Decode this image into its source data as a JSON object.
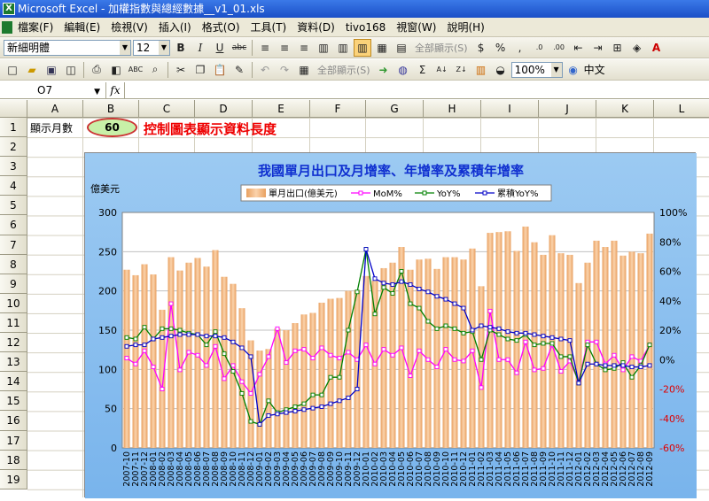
{
  "window": {
    "title": "Microsoft Excel - 加權指數與總經數據__v1_01.xls",
    "app_icon": "excel-icon"
  },
  "menu": [
    "檔案(F)",
    "編輯(E)",
    "檢視(V)",
    "插入(I)",
    "格式(O)",
    "工具(T)",
    "資料(D)",
    "tivo168",
    "視窗(W)",
    "說明(H)"
  ],
  "toolbar": {
    "font": "新細明體",
    "size": "12",
    "show_all_1": "全部顯示(S)",
    "show_all_2": "全部顯示(S)",
    "zoom": "100%",
    "lang": "中文"
  },
  "formula_bar": {
    "cell_ref": "O7",
    "fx": "fx",
    "content": ""
  },
  "columns": [
    "A",
    "B",
    "C",
    "D",
    "E",
    "F",
    "G",
    "H",
    "I",
    "J",
    "K",
    "L"
  ],
  "rows": [
    "1",
    "2",
    "3",
    "4",
    "5",
    "6",
    "7",
    "8",
    "9",
    "10",
    "11",
    "12",
    "13",
    "14",
    "15",
    "16",
    "17",
    "18",
    "19"
  ],
  "sheet": {
    "a1_label": "顯示月數",
    "b1_value": "60",
    "c1_note": "控制圖表顯示資料長度"
  },
  "colors": {
    "bar": "#f2bc8c",
    "mom": "#ff00ff",
    "yoy": "#008000",
    "cum": "#0000c8",
    "title": "#1030d0",
    "neg_axis": "#e00000"
  },
  "chart_data": {
    "type": "bar",
    "title": "我國單月出口及月增率、年增率及累積年增率",
    "ylabel": "億美元",
    "ylim": [
      0,
      300
    ],
    "y2lim": [
      -0.6,
      1.0
    ],
    "yticks": [
      "0",
      "50",
      "100",
      "150",
      "200",
      "250",
      "300"
    ],
    "y2ticks": [
      "-60%",
      "-40%",
      "-20%",
      "0%",
      "20%",
      "40%",
      "60%",
      "80%",
      "100%"
    ],
    "legend": [
      "單月出口(億美元)",
      "MoM%",
      "YoY%",
      "累積YoY%"
    ],
    "legend_position": "top",
    "categories": [
      "2007-10",
      "2007-11",
      "2007-12",
      "2008-01",
      "2008-02",
      "2008-03",
      "2008-04",
      "2008-05",
      "2008-06",
      "2008-07",
      "2008-08",
      "2008-09",
      "2008-10",
      "2008-11",
      "2008-12",
      "2009-01",
      "2009-02",
      "2009-03",
      "2009-04",
      "2009-05",
      "2009-06",
      "2009-07",
      "2009-08",
      "2009-09",
      "2009-10",
      "2009-11",
      "2009-12",
      "2010-01",
      "2010-02",
      "2010-03",
      "2010-04",
      "2010-05",
      "2010-06",
      "2010-07",
      "2010-08",
      "2010-09",
      "2010-10",
      "2010-11",
      "2010-12",
      "2011-01",
      "2011-02",
      "2011-03",
      "2011-04",
      "2011-05",
      "2011-06",
      "2011-07",
      "2011-08",
      "2011-09",
      "2011-10",
      "2011-11",
      "2011-12",
      "2012-01",
      "2012-02",
      "2012-03",
      "2012-04",
      "2012-05",
      "2012-06",
      "2012-07",
      "2012-08",
      "2012-09"
    ],
    "series": [
      {
        "name": "單月出口(億美元)",
        "type": "bar",
        "values": [
          227,
          220,
          234,
          221,
          176,
          243,
          226,
          236,
          242,
          231,
          252,
          218,
          209,
          178,
          137,
          124,
          126,
          152,
          150,
          159,
          170,
          172,
          185,
          190,
          191,
          200,
          201,
          219,
          213,
          229,
          236,
          256,
          227,
          240,
          241,
          228,
          243,
          243,
          240,
          254,
          206,
          274,
          275,
          276,
          251,
          282,
          262,
          246,
          271,
          248,
          246,
          210,
          236,
          264,
          256,
          264,
          245,
          250,
          248,
          273
        ]
      },
      {
        "name": "MoM%",
        "type": "line",
        "values": [
          0.01,
          -0.03,
          0.06,
          -0.05,
          -0.2,
          0.38,
          -0.07,
          0.05,
          0.03,
          -0.04,
          0.09,
          -0.13,
          -0.04,
          -0.15,
          -0.23,
          -0.1,
          0.02,
          0.21,
          -0.02,
          0.06,
          0.07,
          0.01,
          0.08,
          0.03,
          0.01,
          0.05,
          0.0,
          0.1,
          -0.03,
          0.07,
          0.03,
          0.08,
          -0.11,
          0.06,
          0.0,
          -0.05,
          0.07,
          0.0,
          -0.01,
          0.06,
          -0.19,
          0.33,
          0.0,
          0.0,
          -0.09,
          0.12,
          -0.07,
          -0.06,
          0.1,
          -0.08,
          -0.01,
          -0.15,
          0.12,
          0.12,
          -0.03,
          0.03,
          -0.07,
          0.02,
          -0.01,
          0.1
        ]
      },
      {
        "name": "YoY%",
        "type": "line",
        "values": [
          0.15,
          0.14,
          0.22,
          0.14,
          0.21,
          0.21,
          0.2,
          0.18,
          0.17,
          0.1,
          0.19,
          0.04,
          -0.08,
          -0.23,
          -0.42,
          -0.44,
          -0.28,
          -0.36,
          -0.34,
          -0.32,
          -0.3,
          -0.24,
          -0.24,
          -0.12,
          -0.12,
          0.2,
          0.46,
          0.75,
          0.31,
          0.49,
          0.45,
          0.6,
          0.38,
          0.35,
          0.26,
          0.21,
          0.23,
          0.21,
          0.18,
          0.19,
          0.0,
          0.2,
          0.17,
          0.14,
          0.13,
          0.17,
          0.1,
          0.11,
          0.11,
          0.02,
          0.02,
          -0.16,
          0.1,
          -0.03,
          -0.07,
          -0.06,
          -0.02,
          -0.12,
          -0.04,
          0.1
        ]
      },
      {
        "name": "累積YoY%",
        "type": "line",
        "values": [
          0.09,
          0.1,
          0.1,
          0.14,
          0.15,
          0.16,
          0.17,
          0.17,
          0.17,
          0.16,
          0.16,
          0.15,
          0.12,
          0.08,
          0.02,
          -0.44,
          -0.38,
          -0.37,
          -0.36,
          -0.35,
          -0.34,
          -0.33,
          -0.32,
          -0.3,
          -0.28,
          -0.26,
          -0.2,
          0.75,
          0.55,
          0.52,
          0.51,
          0.53,
          0.51,
          0.48,
          0.46,
          0.43,
          0.41,
          0.38,
          0.35,
          0.2,
          0.23,
          0.22,
          0.21,
          0.19,
          0.18,
          0.18,
          0.17,
          0.16,
          0.15,
          0.14,
          0.13,
          -0.16,
          -0.03,
          -0.03,
          -0.04,
          -0.04,
          -0.04,
          -0.05,
          -0.05,
          -0.04
        ]
      }
    ]
  }
}
